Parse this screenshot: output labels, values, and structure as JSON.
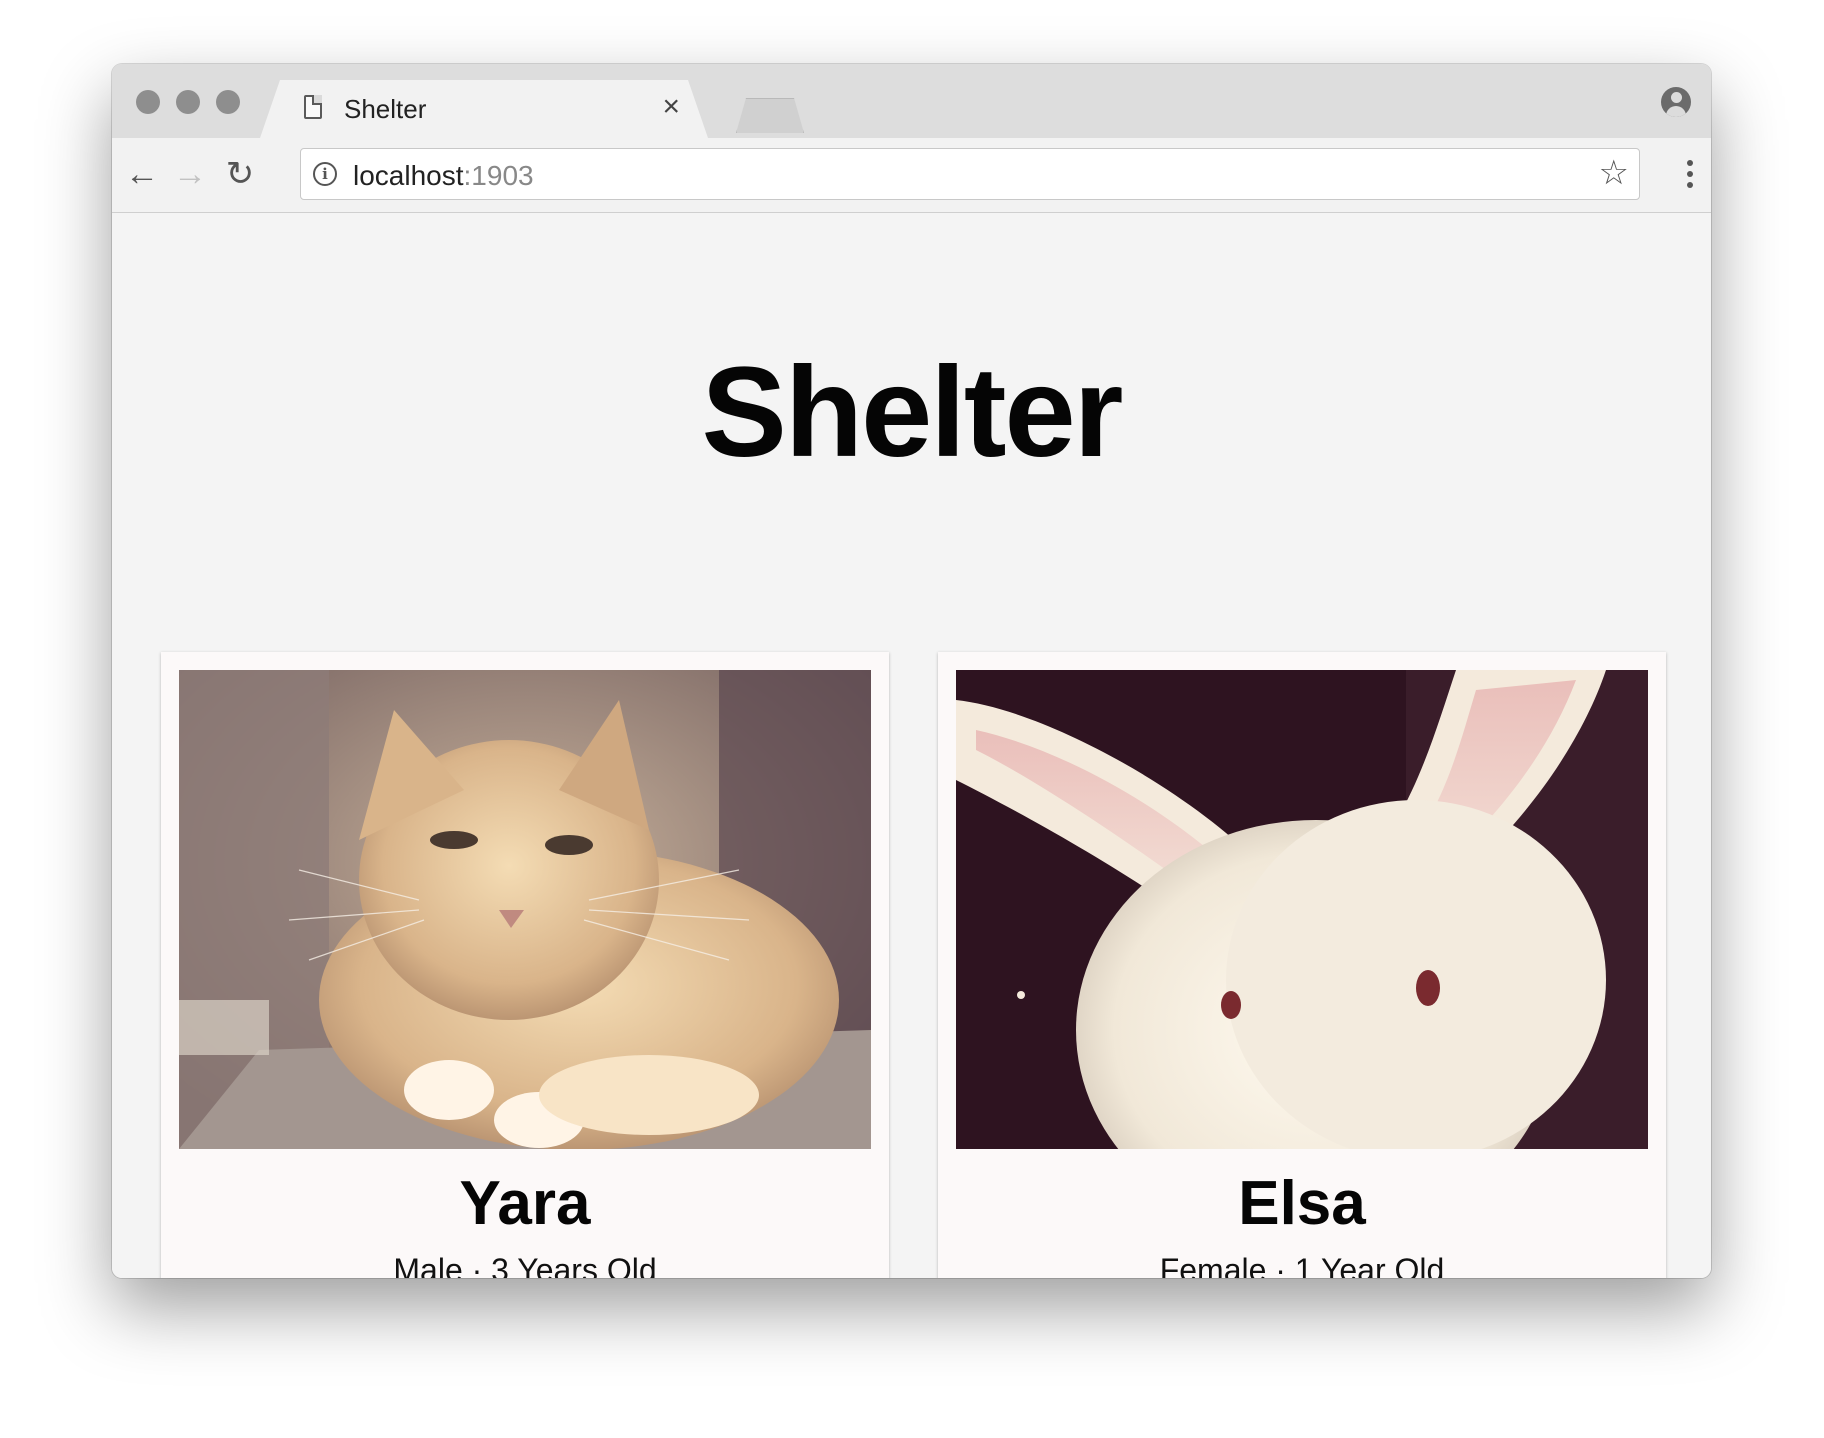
{
  "browser": {
    "tab_title": "Shelter",
    "tab_close": "×",
    "url_host": "localhost",
    "url_port": ":1903",
    "nav": {
      "back": "←",
      "forward": "→",
      "reload": "↻"
    },
    "bookmark_icon": "star-icon",
    "info_icon_glyph": "i"
  },
  "page": {
    "title": "Shelter",
    "pets": [
      {
        "name": "Yara",
        "details": "Male · 3 Years Old",
        "photo": "cat-photo"
      },
      {
        "name": "Elsa",
        "details": "Female · 1 Year Old",
        "photo": "rabbit-photo"
      }
    ]
  }
}
